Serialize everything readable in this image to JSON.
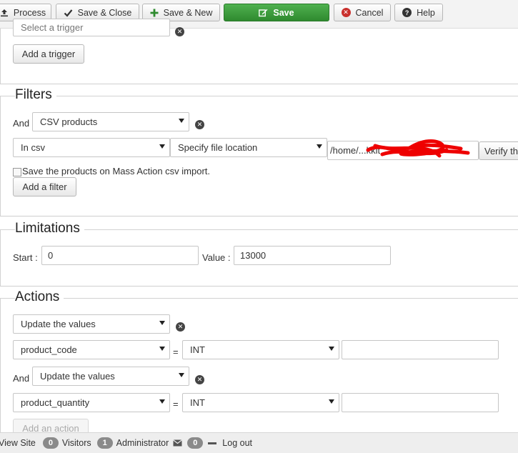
{
  "toolbar": {
    "process_label": "Process",
    "save_close_label": "Save & Close",
    "save_new_label": "Save & New",
    "save_label": "Save",
    "cancel_label": "Cancel",
    "help_label": "Help"
  },
  "triggers": {
    "select_value": "Select a trigger",
    "add_button": "Add a trigger"
  },
  "filters": {
    "title": "Filters",
    "and_label": "And",
    "filter_type": "CSV products",
    "in_csv": "In csv",
    "location_mode": "Specify file location",
    "path_value": "/home/...kkit",
    "verify_button": "Verify th",
    "checkbox_label": "Save the products on Mass Action csv import.",
    "add_button": "Add a filter"
  },
  "limitations": {
    "title": "Limitations",
    "start_label": "Start :",
    "start_value": "0",
    "value_label": "Value :",
    "value_value": "13000"
  },
  "actions": {
    "title": "Actions",
    "and_label": "And",
    "equals": "=",
    "rows": [
      {
        "action": "Update the values",
        "field": "product_code",
        "type": "INT",
        "value": ""
      },
      {
        "action": "Update the values",
        "field": "product_quantity",
        "type": "INT",
        "value": ""
      }
    ],
    "add_button": "Add an action"
  },
  "statusbar": {
    "view_site": "View Site",
    "visitors_count": "0",
    "visitors_label": "Visitors",
    "admin_count": "1",
    "admin_label": "Administrator",
    "messages_count": "0",
    "logout_label": "Log out"
  },
  "colors": {
    "save_green": "#3c9c3c",
    "annotation_red": "#ee0000"
  }
}
